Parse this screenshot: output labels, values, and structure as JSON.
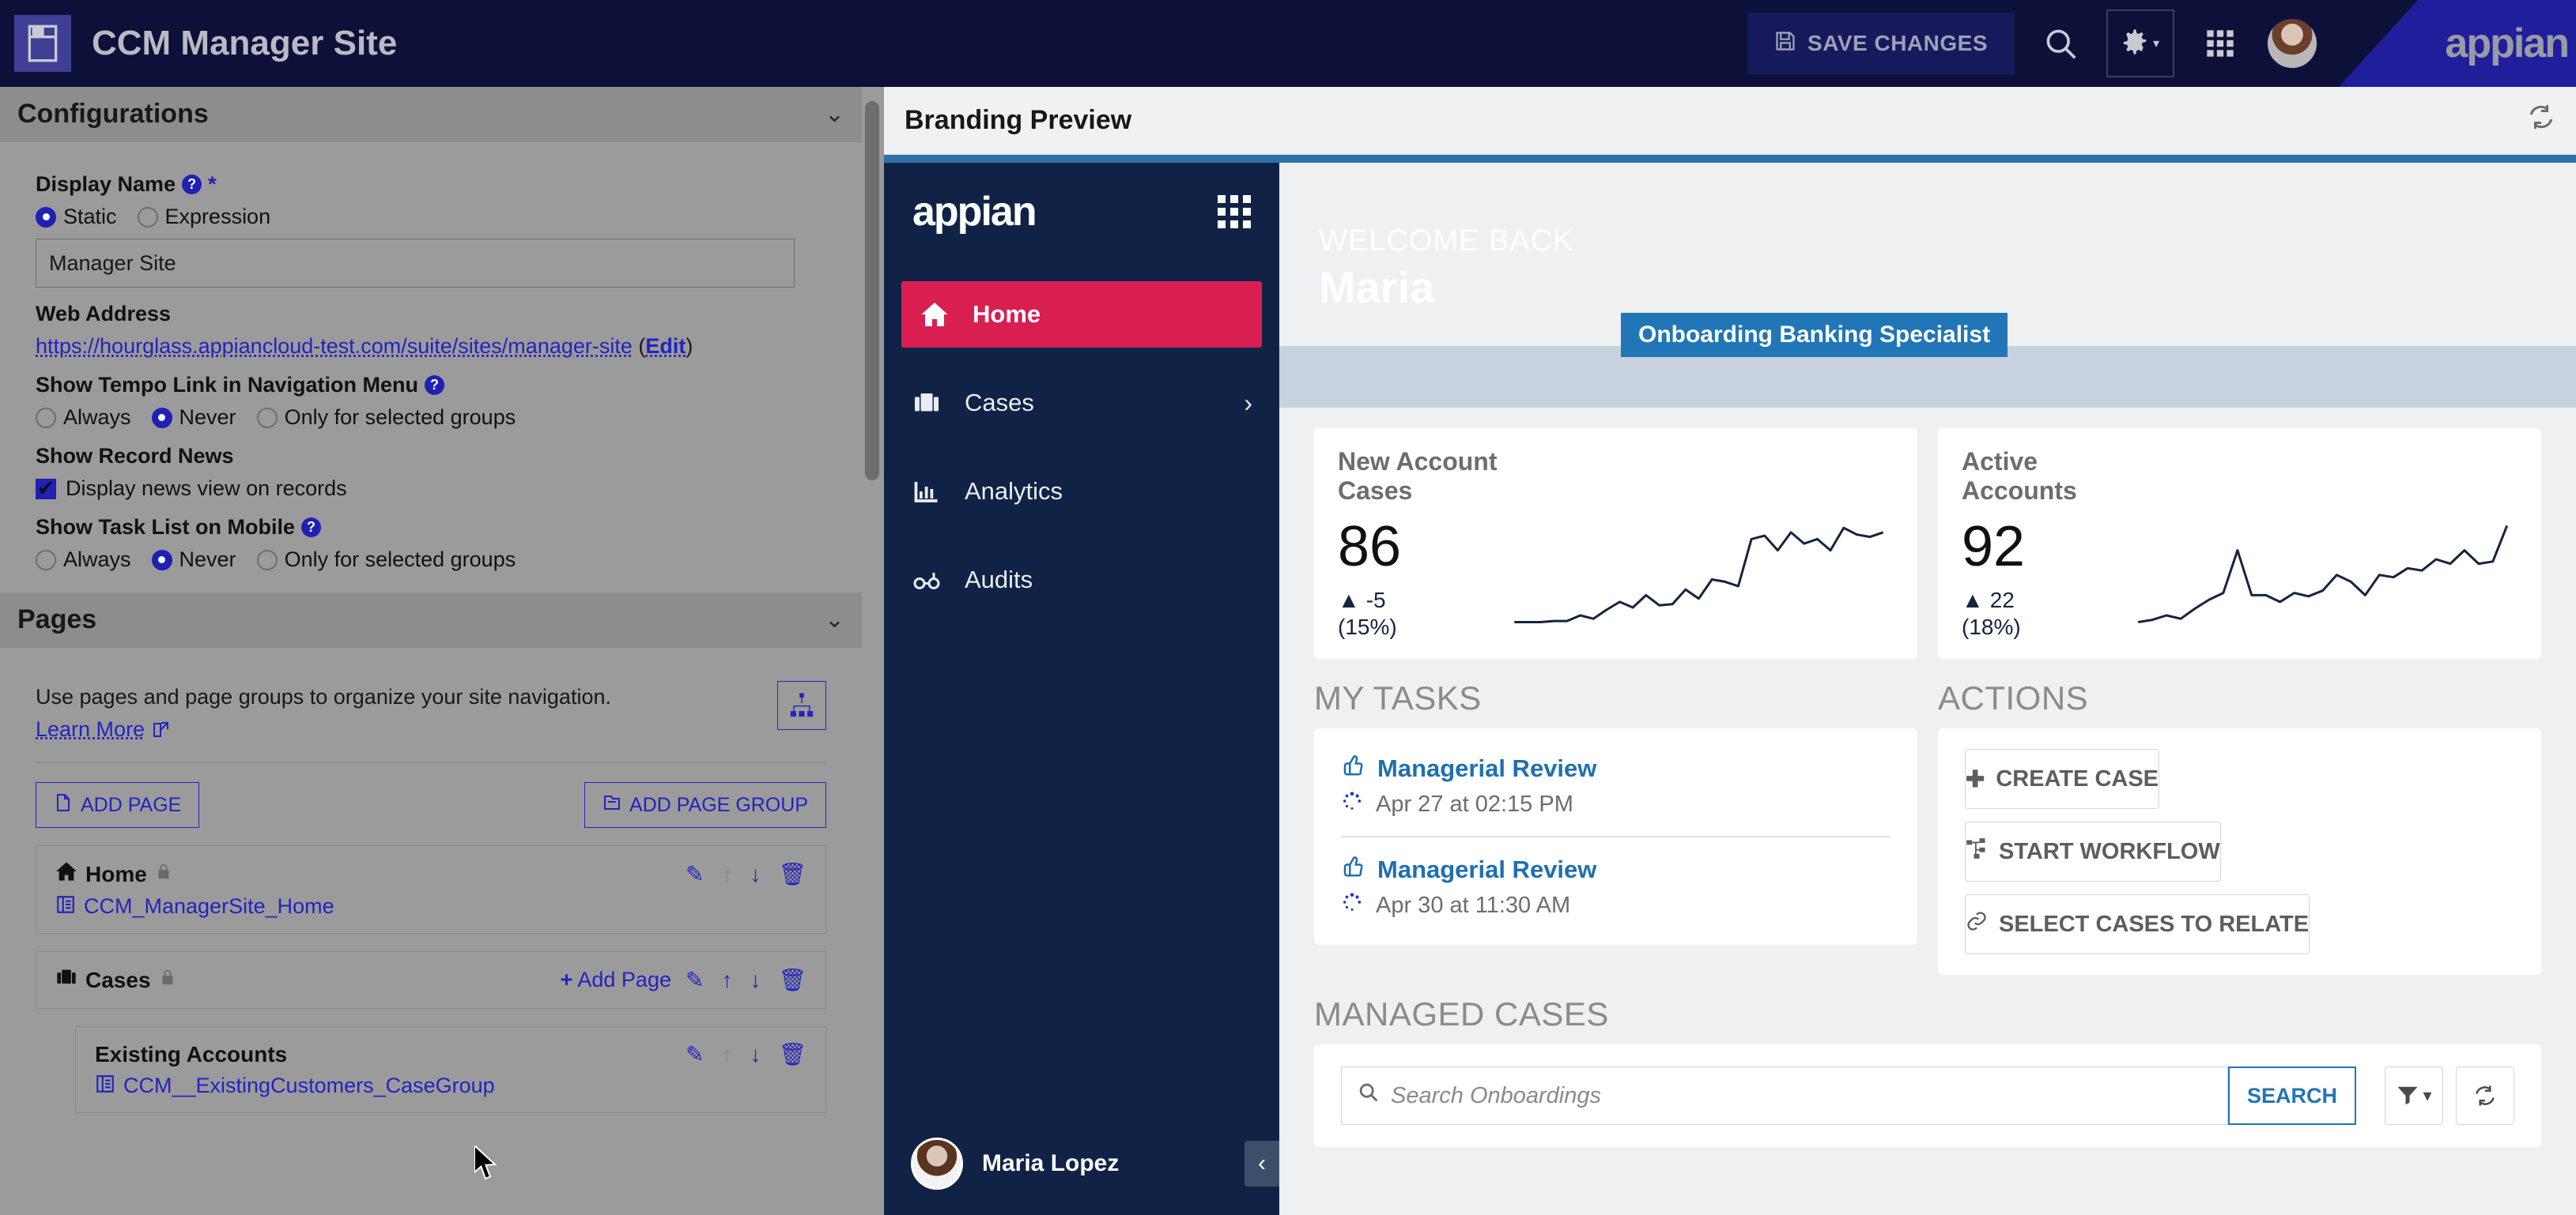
{
  "appbar": {
    "title": "CCM Manager Site",
    "save_label": "SAVE CHANGES",
    "brand": "appian",
    "icons": {
      "save": "save-icon",
      "search": "search-icon",
      "gear": "gear-icon",
      "grid": "grid-apps-icon"
    }
  },
  "configurations": {
    "header": "Configurations",
    "chevron": "⌄",
    "display_name": {
      "label": "Display Name",
      "required": "*",
      "options": [
        "Static",
        "Expression"
      ],
      "selected": "Static",
      "value": "Manager Site"
    },
    "web_address": {
      "label": "Web Address",
      "url": "https://hourglass.appiancloud-test.com/suite/sites/manager-site",
      "edit_prefix": " (",
      "edit": "Edit",
      "edit_suffix": ")"
    },
    "tempo_link": {
      "label": "Show Tempo Link in Navigation Menu",
      "options": [
        "Always",
        "Never",
        "Only for selected groups"
      ],
      "selected": "Never"
    },
    "record_news": {
      "label": "Show Record News",
      "checkbox_label": "Display news view on records",
      "checked": true
    },
    "task_list_mobile": {
      "label": "Show Task List on Mobile",
      "options": [
        "Always",
        "Never",
        "Only for selected groups"
      ],
      "selected": "Never"
    }
  },
  "pages": {
    "header": "Pages",
    "chevron": "⌄",
    "description": "Use pages and page groups to organize your site navigation.",
    "learn_more": "Learn More",
    "add_page": "ADD PAGE",
    "add_page_group": "ADD PAGE GROUP",
    "items": [
      {
        "name": "Home",
        "object": "CCM_ManagerSite_Home",
        "icon": "home-icon",
        "locked": true,
        "add_page": null,
        "indent": false
      },
      {
        "name": "Cases",
        "object": null,
        "icon": "briefcase-icon",
        "locked": true,
        "add_page": "Add Page",
        "indent": false
      },
      {
        "name": "Existing Accounts",
        "object": "CCM__ExistingCustomers_CaseGroup",
        "icon": null,
        "locked": false,
        "add_page": null,
        "indent": true
      }
    ]
  },
  "branding_preview": {
    "header": "Branding Preview",
    "refresh_icon": "refresh-icon",
    "nav": {
      "logo": "appian",
      "grid_icon": "grid-apps-icon",
      "items": [
        {
          "label": "Home",
          "icon": "home-icon",
          "active": true,
          "caret": null
        },
        {
          "label": "Cases",
          "icon": "briefcase-icon",
          "active": false,
          "caret": "›"
        },
        {
          "label": "Analytics",
          "icon": "bar-chart-icon",
          "active": false,
          "caret": null
        },
        {
          "label": "Audits",
          "icon": "glasses-icon",
          "active": false,
          "caret": null
        }
      ],
      "user": "Maria Lopez",
      "collapse_icon": "‹"
    },
    "hero": {
      "welcome": "WELCOME BACK",
      "name": "Maria",
      "role_badge": "Onboarding Banking Specialist"
    },
    "kpis": [
      {
        "title": "New Account Cases",
        "value": "86",
        "delta": "-5",
        "delta_arrow": "▲",
        "percent": "(15%)"
      },
      {
        "title": "Active Accounts",
        "value": "92",
        "delta": "22",
        "delta_arrow": "▲",
        "percent": "(18%)"
      }
    ],
    "my_tasks": {
      "title": "MY TASKS",
      "tasks": [
        {
          "name": "Managerial Review",
          "date": "Apr 27 at 02:15 PM"
        },
        {
          "name": "Managerial Review",
          "date": "Apr 30 at 11:30 AM"
        }
      ]
    },
    "actions": {
      "title": "ACTIONS",
      "buttons": [
        {
          "label": "CREATE CASE",
          "icon": "plus-icon"
        },
        {
          "label": "START WORKFLOW",
          "icon": "workflow-icon"
        },
        {
          "label": "SELECT CASES TO RELATE",
          "icon": "link-icon"
        }
      ]
    },
    "managed_cases": {
      "title": "MANAGED CASES",
      "search_placeholder": "Search Onboardings",
      "search_value": "",
      "search_button": "SEARCH",
      "filter_icon": "filter-icon",
      "refresh_icon": "refresh-icon"
    }
  },
  "chart_data": [
    {
      "type": "line",
      "title": "New Account Cases",
      "x": [
        0,
        1,
        2,
        3,
        4,
        5,
        6,
        7,
        8,
        9,
        10,
        11,
        12,
        13,
        14,
        15,
        16,
        17,
        18,
        19,
        20,
        21,
        22,
        23,
        24,
        25,
        26
      ],
      "values": [
        6,
        6,
        6,
        7,
        7,
        12,
        9,
        17,
        24,
        19,
        30,
        21,
        22,
        35,
        27,
        44,
        42,
        38,
        80,
        83,
        70,
        86,
        76,
        80,
        70,
        90,
        84,
        82,
        86
      ],
      "ylim": [
        0,
        100
      ],
      "grid": false,
      "legend": "none"
    },
    {
      "type": "line",
      "title": "Active Accounts",
      "x": [
        0,
        1,
        2,
        3,
        4,
        5,
        6,
        7,
        8,
        9,
        10,
        11,
        12,
        13,
        14,
        15,
        16,
        17,
        18,
        19,
        20,
        21,
        22,
        23,
        24,
        25,
        26
      ],
      "values": [
        6,
        8,
        12,
        9,
        18,
        26,
        32,
        70,
        30,
        30,
        24,
        32,
        29,
        34,
        48,
        42,
        30,
        48,
        46,
        54,
        52,
        62,
        58,
        70,
        58,
        60,
        92
      ],
      "ylim": [
        0,
        100
      ],
      "grid": false,
      "legend": "none"
    }
  ],
  "colors": {
    "appbar_bg": "#0d1038",
    "brand_wedge": "#1f1f9c",
    "nav_bg": "#102346",
    "nav_active": "#d91f52",
    "accent_blue": "#2176b7",
    "link_blue": "#2323c0",
    "panel_bg": "#9b9b9b"
  }
}
